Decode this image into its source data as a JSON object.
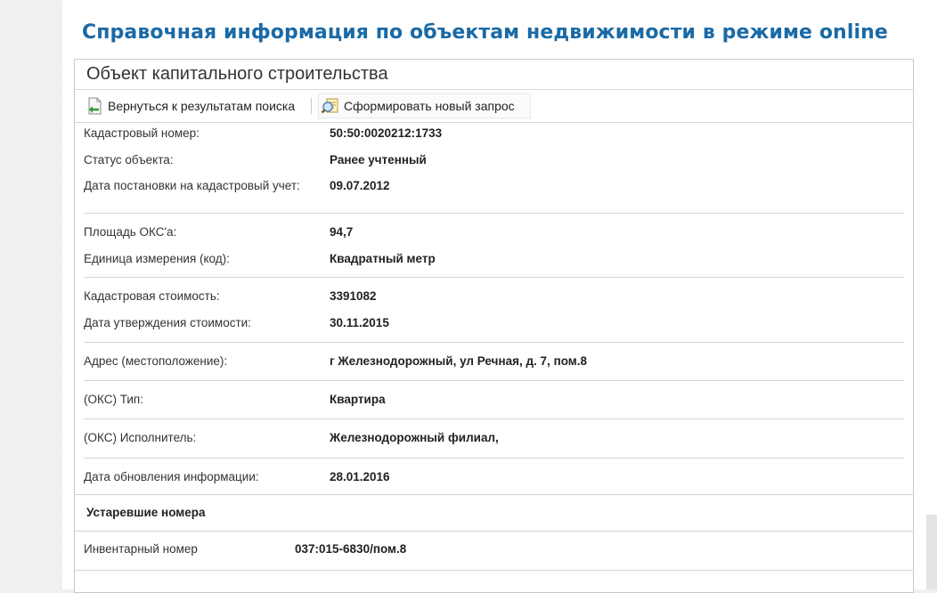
{
  "page": {
    "title": "Справочная информация по объектам недвижимости в режиме online"
  },
  "panel": {
    "header": "Объект капитального строительства"
  },
  "toolbar": {
    "back_label": "Вернуться к результатам поиска",
    "new_query_label": "Сформировать новый запрос"
  },
  "info": {
    "cadastral_number": {
      "label": "Кадастровый номер:",
      "value": "50:50:0020212:1733"
    },
    "status": {
      "label": "Статус объекта:",
      "value": "Ранее учтенный"
    },
    "registration_date": {
      "label": "Дата постановки на кадастровый учет:",
      "value": "09.07.2012"
    },
    "area": {
      "label": "Площадь ОКС'а:",
      "value": "94,7"
    },
    "unit": {
      "label": "Единица измерения (код):",
      "value": "Квадратный метр"
    },
    "cost": {
      "label": "Кадастровая стоимость:",
      "value": "3391082"
    },
    "cost_date": {
      "label": "Дата утверждения стоимости:",
      "value": "30.11.2015"
    },
    "address": {
      "label": "Адрес (местоположение):",
      "value": "г Железнодорожный, ул Речная, д. 7, пом.8"
    },
    "type": {
      "label": "(ОКС) Тип:",
      "value": "Квартира"
    },
    "executor": {
      "label": "(ОКС) Исполнитель:",
      "value": "Железнодорожный филиал,"
    },
    "update_date": {
      "label": "Дата обновления информации:",
      "value": "28.01.2016"
    }
  },
  "obsolete": {
    "heading": "Устаревшие номера",
    "inventory": {
      "label": "Инвентарный номер",
      "value": "037:015-6830/пом.8"
    }
  },
  "colors": {
    "title": "#1a6aa6",
    "border": "#c9c9c9"
  },
  "icons": {
    "back": "document-back-arrow-icon",
    "new_query": "search-document-icon"
  }
}
